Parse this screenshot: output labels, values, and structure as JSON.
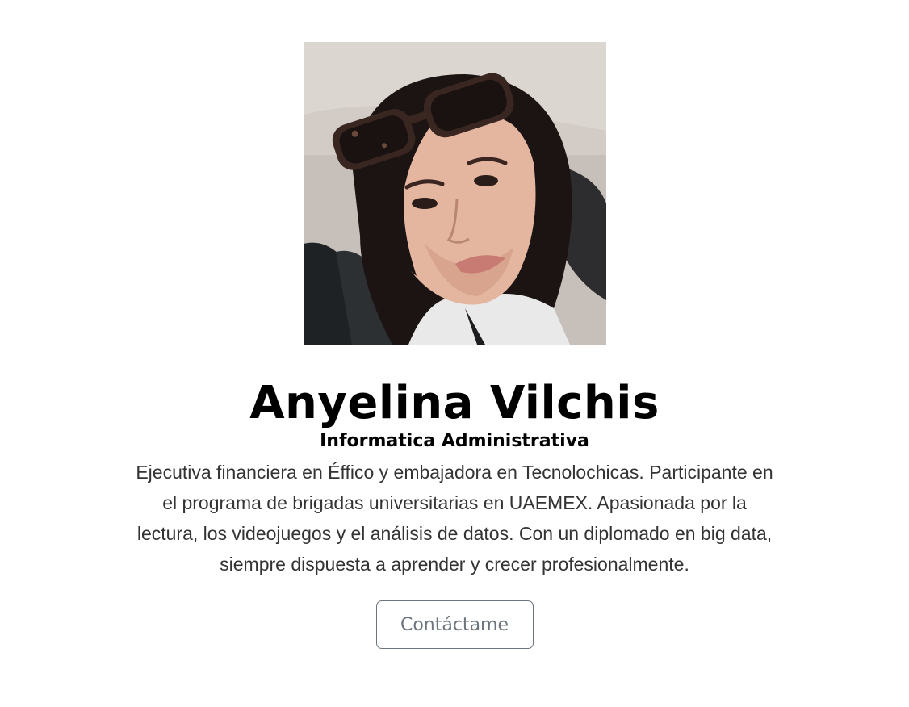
{
  "profile": {
    "photo_alt": "Anyelina Vilchis",
    "name": "Anyelina Vilchis",
    "career": "Informatica Administrativa",
    "bio": "Ejecutiva financiera en Éffico y embajadora en Tecnolochicas. Participante en el programa de brigadas universitarias en UAEMEX. Apasionada por la lectura, los videojuegos y el análisis de datos. Con un diplomado en big data, siempre dispuesta a aprender y crecer profesionalmente.",
    "contact_label": "Contáctame"
  },
  "colors": {
    "button_border": "#6c757d",
    "button_text": "#6c757d",
    "text": "#000000"
  }
}
